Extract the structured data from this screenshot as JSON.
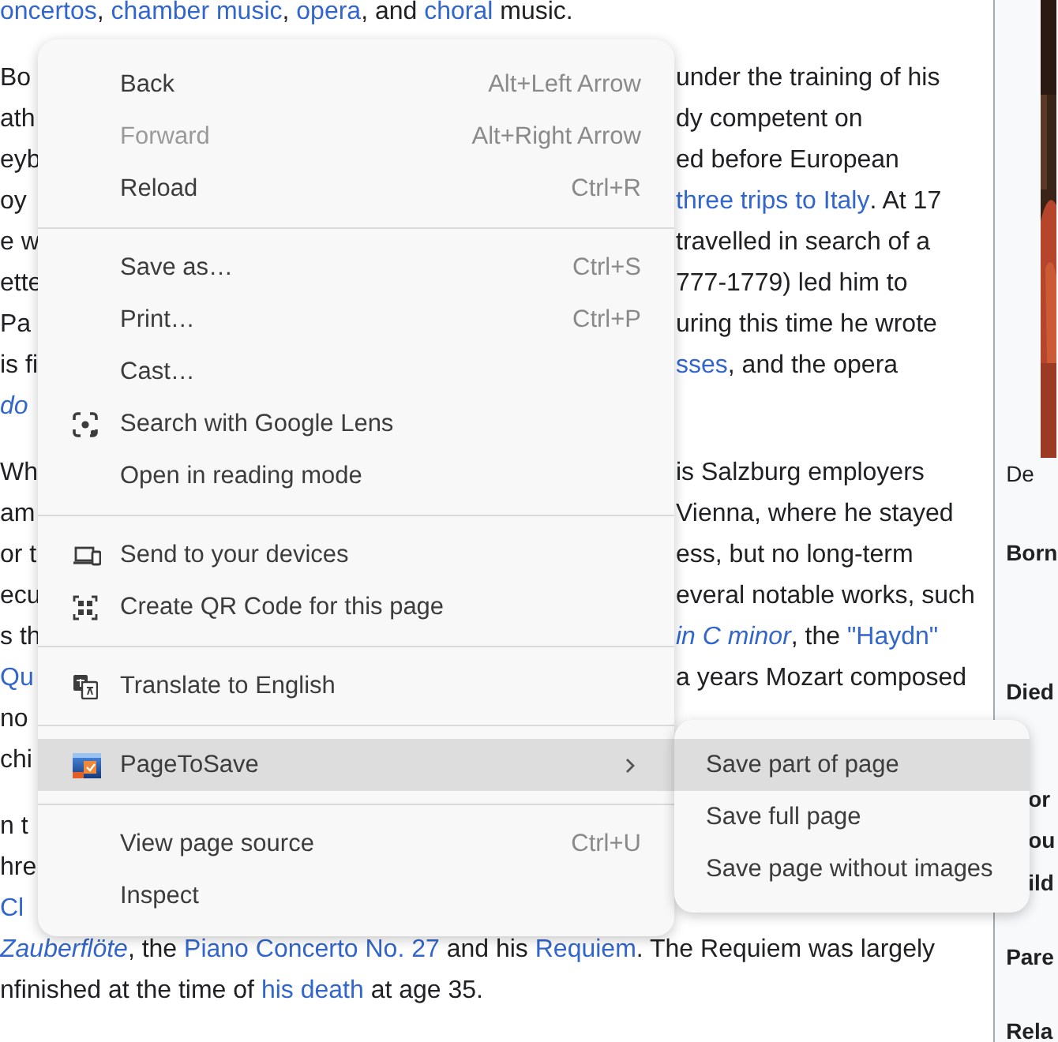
{
  "article": {
    "paragraphs": [
      [
        {
          "left": [
            {
              "text": "oncertos",
              "kind": "link"
            },
            {
              "text": ", ",
              "kind": "plain"
            },
            {
              "text": "chamber music",
              "kind": "link"
            },
            {
              "text": ", ",
              "kind": "plain"
            },
            {
              "text": "opera",
              "kind": "link"
            },
            {
              "text": ", and ",
              "kind": "plain"
            },
            {
              "text": "choral",
              "kind": "link"
            },
            {
              "text": " music.",
              "kind": "plain"
            }
          ]
        }
      ],
      [
        {
          "left": [
            {
              "text": "Bo",
              "kind": "plain"
            }
          ],
          "right": [
            {
              "text": "under the training of his",
              "kind": "plain"
            }
          ]
        },
        {
          "left": [
            {
              "text": "ath",
              "kind": "plain"
            }
          ],
          "right": [
            {
              "text": "dy competent on",
              "kind": "plain"
            }
          ]
        },
        {
          "left": [
            {
              "text": "eyb",
              "kind": "plain"
            }
          ],
          "right": [
            {
              "text": "ed before European",
              "kind": "plain"
            }
          ]
        },
        {
          "left": [
            {
              "text": "oy",
              "kind": "plain"
            }
          ],
          "right": [
            {
              "text": "three trips to Italy",
              "kind": "link"
            },
            {
              "text": ". At 17",
              "kind": "plain"
            }
          ]
        },
        {
          "left": [
            {
              "text": "e w",
              "kind": "plain"
            }
          ],
          "right": [
            {
              "text": "travelled in search of a",
              "kind": "plain"
            }
          ]
        },
        {
          "left": [
            {
              "text": "ette",
              "kind": "plain"
            }
          ],
          "right": [
            {
              "text": "777-1779) led him to",
              "kind": "plain"
            }
          ]
        },
        {
          "left": [
            {
              "text": "Pa",
              "kind": "plain"
            }
          ],
          "right": [
            {
              "text": "uring this time he wrote",
              "kind": "plain"
            }
          ]
        },
        {
          "left": [
            {
              "text": "is fi",
              "kind": "plain"
            }
          ],
          "right": [
            {
              "text": "sses",
              "kind": "link"
            },
            {
              "text": ", and the opera",
              "kind": "plain"
            }
          ]
        },
        {
          "left": [
            {
              "text": "do",
              "kind": "italic_link"
            }
          ]
        }
      ],
      [
        {
          "left": [
            {
              "text": "Wh",
              "kind": "plain"
            }
          ],
          "right": [
            {
              "text": "is Salzburg employers",
              "kind": "plain"
            }
          ]
        },
        {
          "left": [
            {
              "text": "am",
              "kind": "plain"
            }
          ],
          "right": [
            {
              "text": "Vienna, where he stayed",
              "kind": "plain"
            }
          ]
        },
        {
          "left": [
            {
              "text": "or t",
              "kind": "plain"
            }
          ],
          "right": [
            {
              "text": "ess, but no long-term",
              "kind": "plain"
            }
          ]
        },
        {
          "left": [
            {
              "text": "ecu",
              "kind": "plain"
            }
          ],
          "right": [
            {
              "text": "everal notable works, such",
              "kind": "plain"
            }
          ]
        },
        {
          "left": [
            {
              "text": "s th",
              "kind": "plain"
            }
          ],
          "right": [
            {
              "text": "in C minor",
              "kind": "italic_link"
            },
            {
              "text": ", the ",
              "kind": "plain"
            },
            {
              "text": "\"Haydn\"",
              "kind": "link"
            }
          ]
        },
        {
          "left": [
            {
              "text": "Qu",
              "kind": "link"
            }
          ],
          "right": [
            {
              "text": "a years Mozart composed",
              "kind": "plain"
            }
          ]
        },
        {
          "left": [
            {
              "text": "no",
              "kind": "plain"
            }
          ]
        },
        {
          "left": [
            {
              "text": "chi",
              "kind": "plain"
            }
          ]
        }
      ],
      [
        {
          "left": [
            {
              "text": "n t",
              "kind": "plain"
            }
          ]
        },
        {
          "left": [
            {
              "text": "hre",
              "kind": "plain"
            }
          ]
        },
        {
          "left": [
            {
              "text": "Cl",
              "kind": "link"
            }
          ]
        },
        {
          "left": [
            {
              "text": "Zauberflöte",
              "kind": "italic_link"
            },
            {
              "text": ", the ",
              "kind": "plain"
            },
            {
              "text": "Piano Concerto No. 27",
              "kind": "link"
            },
            {
              "text": " and his ",
              "kind": "plain"
            },
            {
              "text": "Requiem",
              "kind": "link"
            },
            {
              "text": ". The Requiem was largely",
              "kind": "plain"
            }
          ]
        },
        {
          "left": [
            {
              "text": "nfinished at the time of ",
              "kind": "plain"
            },
            {
              "text": "his death",
              "kind": "link"
            },
            {
              "text": " at age 35.",
              "kind": "plain"
            }
          ]
        }
      ]
    ]
  },
  "infobox": {
    "caption": "De",
    "labels": [
      {
        "text": "Born",
        "kind": "full"
      },
      {
        "text": "Died",
        "kind": "full"
      },
      {
        "text": "or",
        "kind": "partial"
      },
      {
        "text": "ou",
        "kind": "partial"
      },
      {
        "text": "ild",
        "kind": "partial"
      },
      {
        "text": "Pare",
        "kind": "full"
      },
      {
        "text": "Rela",
        "kind": "full"
      }
    ]
  },
  "context_menu": {
    "groups": [
      [
        {
          "label": "Back",
          "shortcut": "Alt+Left Arrow",
          "kind": "item",
          "disabled": false,
          "highlighted": false
        },
        {
          "label": "Forward",
          "shortcut": "Alt+Right Arrow",
          "kind": "item",
          "disabled": true,
          "highlighted": false
        },
        {
          "label": "Reload",
          "shortcut": "Ctrl+R",
          "kind": "item",
          "disabled": false,
          "highlighted": false
        }
      ],
      [
        {
          "label": "Save as…",
          "shortcut": "Ctrl+S",
          "kind": "item",
          "disabled": false,
          "highlighted": false
        },
        {
          "label": "Print…",
          "shortcut": "Ctrl+P",
          "kind": "item",
          "disabled": false,
          "highlighted": false
        },
        {
          "label": "Cast…",
          "kind": "item",
          "disabled": false,
          "highlighted": false
        },
        {
          "label": "Search with Google Lens",
          "kind": "lens",
          "disabled": false,
          "highlighted": false
        },
        {
          "label": "Open in reading mode",
          "kind": "item",
          "disabled": false,
          "highlighted": false
        }
      ],
      [
        {
          "label": "Send to your devices",
          "kind": "devices",
          "disabled": false,
          "highlighted": false
        },
        {
          "label": "Create QR Code for this page",
          "kind": "qr",
          "disabled": false,
          "highlighted": false
        }
      ],
      [
        {
          "label": "Translate to English",
          "kind": "translate",
          "disabled": false,
          "highlighted": false
        }
      ],
      [
        {
          "label": "PageToSave",
          "kind": "extension",
          "disabled": false,
          "highlighted": true,
          "has_submenu": true
        }
      ],
      [
        {
          "label": "View page source",
          "shortcut": "Ctrl+U",
          "kind": "item",
          "disabled": false,
          "highlighted": false
        },
        {
          "label": "Inspect",
          "kind": "item",
          "disabled": false,
          "highlighted": false
        }
      ]
    ]
  },
  "submenu": {
    "items": [
      {
        "label": "Save part of page",
        "highlighted": true
      },
      {
        "label": "Save full page",
        "highlighted": false
      },
      {
        "label": "Save page without images",
        "highlighted": false
      }
    ]
  }
}
